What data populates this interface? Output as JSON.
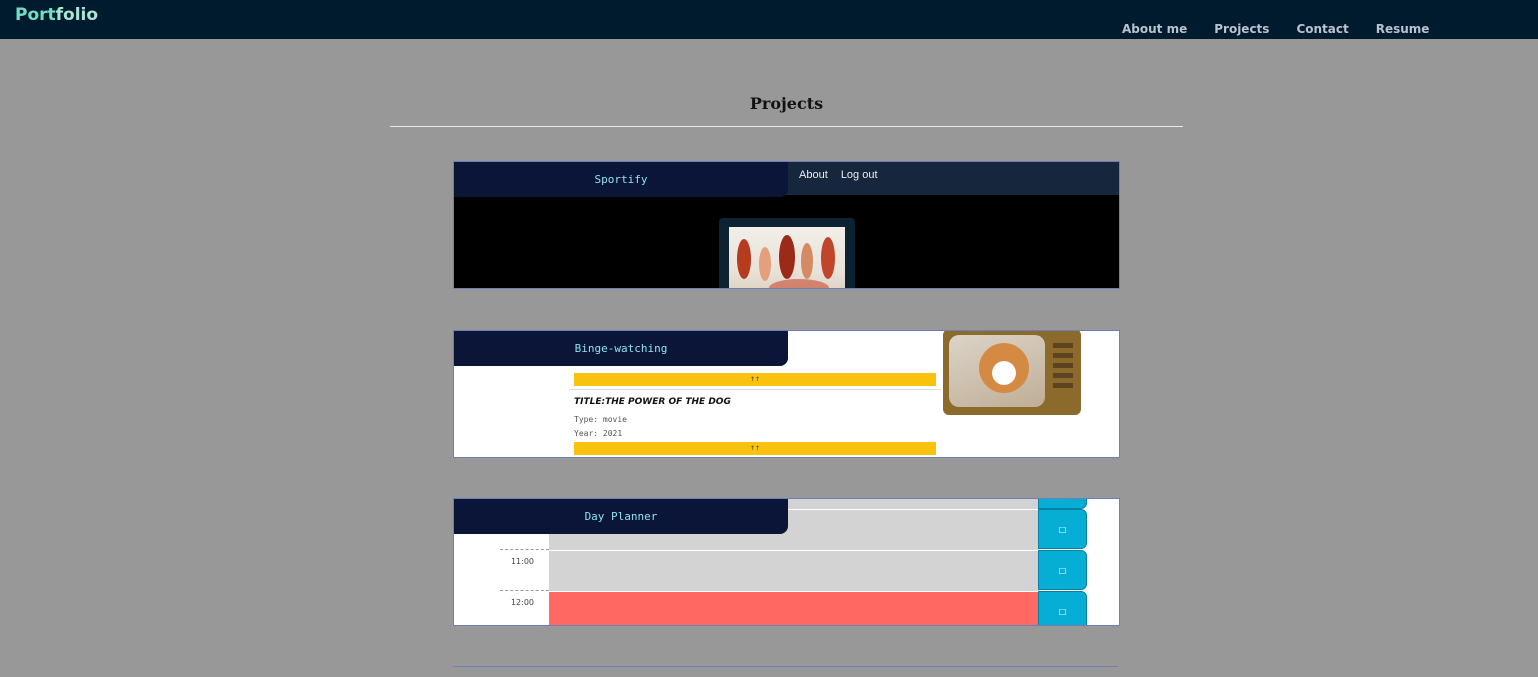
{
  "header": {
    "logo_a": "Port",
    "logo_b": "folio",
    "nav": [
      "About me",
      "Projects",
      "Contact",
      "Resume"
    ]
  },
  "main": {
    "title": "Projects"
  },
  "projects": [
    {
      "label": "Sportify",
      "preview_nav": [
        "About",
        "Log out"
      ]
    },
    {
      "label": "Binge-watching",
      "preview_movie_title": "TITLE:THE POWER OF THE DOG",
      "preview_type": "Type: movie",
      "preview_year": "Year: 2021"
    },
    {
      "label": "Day Planner",
      "preview_hours": [
        "11:00",
        "12:00"
      ]
    }
  ],
  "colors": {
    "topbar": "#001b2e",
    "page_bg": "#989898",
    "tab_bg": "#0b1537",
    "tab_text": "#8de2f2",
    "card_border": "#6e7fb5"
  }
}
